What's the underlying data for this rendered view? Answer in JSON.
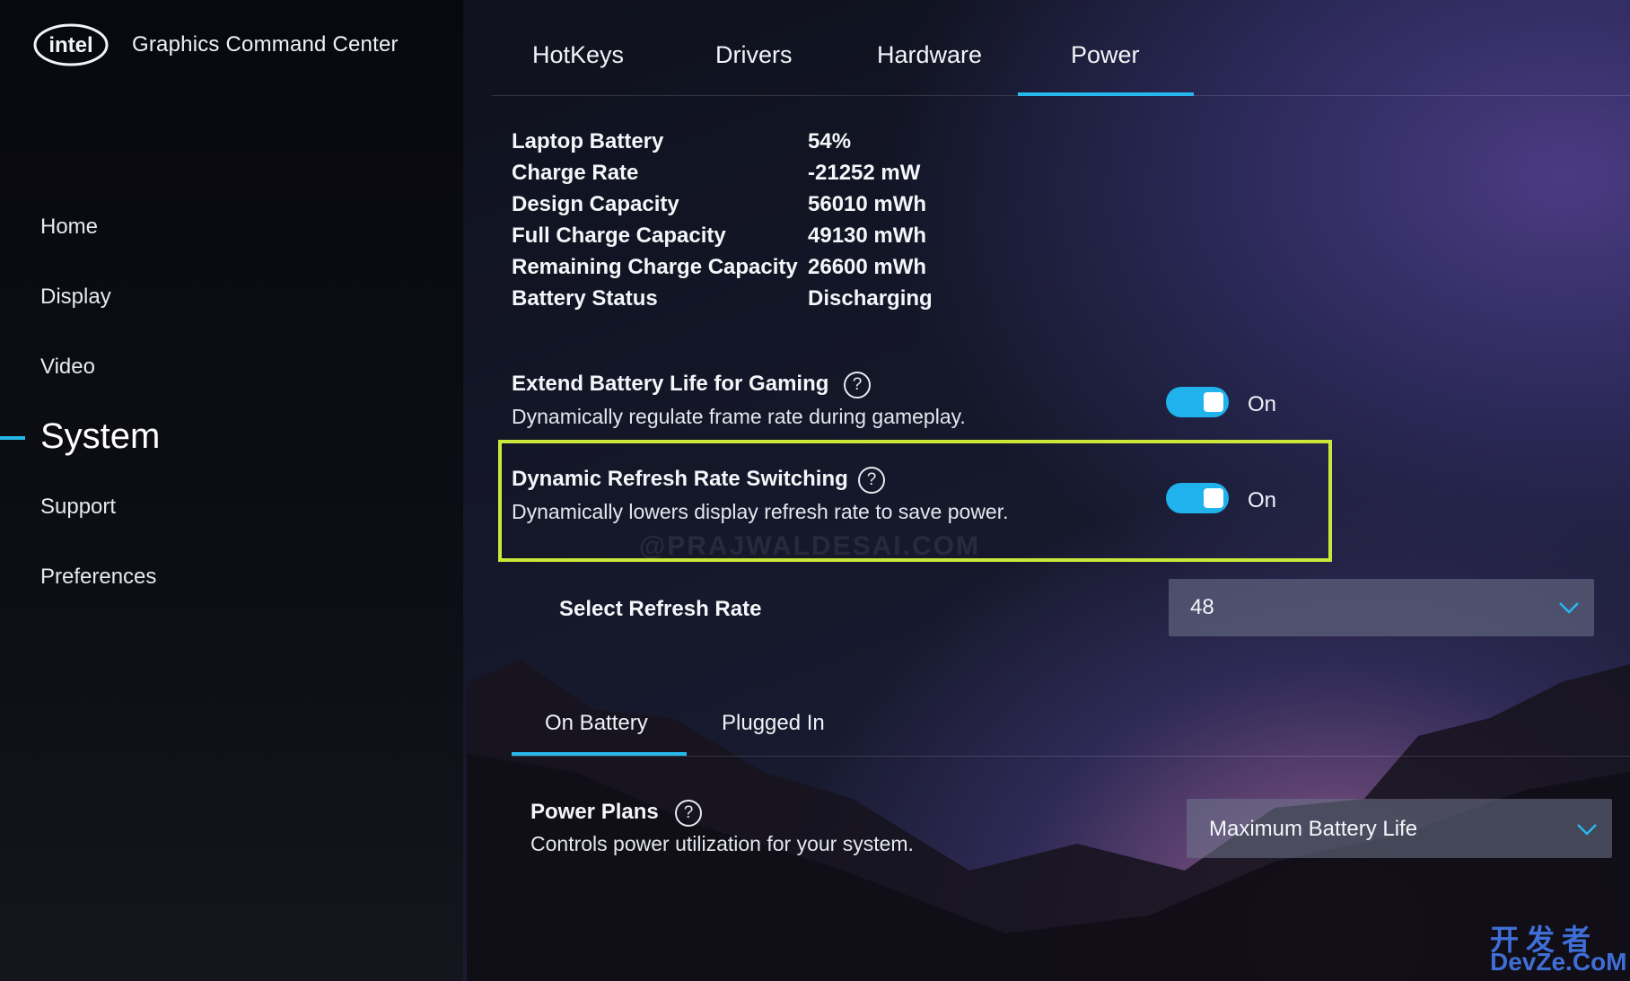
{
  "app": {
    "brand": "intel",
    "title": "Graphics Command Center"
  },
  "sidebar": {
    "items": [
      {
        "label": "Home"
      },
      {
        "label": "Display"
      },
      {
        "label": "Video"
      },
      {
        "label": "System",
        "active": true
      },
      {
        "label": "Support"
      },
      {
        "label": "Preferences"
      }
    ]
  },
  "tabs": [
    {
      "label": "HotKeys"
    },
    {
      "label": "Drivers"
    },
    {
      "label": "Hardware"
    },
    {
      "label": "Power",
      "active": true
    }
  ],
  "battery_info": [
    {
      "label": "Laptop Battery",
      "value": "54%"
    },
    {
      "label": "Charge Rate",
      "value": "-21252 mW"
    },
    {
      "label": "Design Capacity",
      "value": "56010 mWh"
    },
    {
      "label": "Full Charge Capacity",
      "value": "49130 mWh"
    },
    {
      "label": "Remaining Charge Capacity",
      "value": "26600 mWh"
    },
    {
      "label": "Battery Status",
      "value": "Discharging"
    }
  ],
  "settings": {
    "extend_battery": {
      "title": "Extend Battery Life for Gaming",
      "desc": "Dynamically regulate frame rate during gameplay.",
      "state": "On"
    },
    "dynamic_refresh": {
      "title": "Dynamic Refresh Rate Switching",
      "desc": "Dynamically lowers display refresh rate to save power.",
      "state": "On"
    },
    "refresh_rate": {
      "label": "Select Refresh Rate",
      "value": "48"
    }
  },
  "subtabs": [
    {
      "label": "On Battery",
      "active": true
    },
    {
      "label": "Plugged In"
    }
  ],
  "power_plans": {
    "title": "Power Plans",
    "desc": "Controls power utilization for your system.",
    "value": "Maximum Battery Life"
  },
  "help_glyph": "?",
  "watermark": "@PRAJWALDESAI.COM",
  "site_watermark": {
    "cn": "开发者",
    "en": "DevZe.CoM"
  },
  "colors": {
    "accent": "#27b9ee",
    "highlight": "#cbe83a"
  }
}
